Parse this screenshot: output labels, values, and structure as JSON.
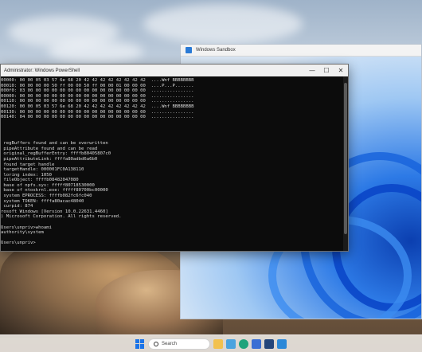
{
  "sandbox": {
    "title": "Windows Sandbox"
  },
  "powershell": {
    "title": "Administrator: Windows PowerShell",
    "lines": [
      "00000: 00 00 05 03 57 6e 68 20 42 42 42 42 42 42 42 42  ....Wnf BBBBBBBB",
      "00010: 00 00 00 00 50 ff 00 00 50 ff 00 00 01 00 00 00  ....P...P.......",
      "000f0: 03 00 00 00 00 00 00 00 00 00 00 00 00 00 00 00  ................",
      "00000: 00 00 00 00 00 00 00 00 00 00 00 00 00 00 00 00  ................",
      "00110: 00 00 00 00 00 00 00 00 00 00 00 00 00 00 00 00  ................",
      "00120: 00 00 05 03 57 6e 68 20 42 42 42 42 42 42 42 42  ....Wnf BBBBBBBB",
      "00130: 00 00 00 00 00 00 00 00 00 00 00 00 00 00 00 00  ................",
      "00140: 04 00 00 00 00 00 00 00 00 00 00 00 00 00 00 00  ................",
      "",
      "",
      "",
      "",
      " regBuffers found and can be overwritten",
      " pipeAttribute found and can be read",
      " original_regBufferEntry: ffffb80405807c0",
      " pipeAttributeLink: ffffa80adbd6a6b0",
      " found target handle",
      " targetHandle: 000001FC0A138110",
      " loring index: 1050",
      " fileObject: ffffb08482047080",
      " base of npfs.sys: fffff80718530000",
      " base of ntoskrnl.exe: fffff80700bc00000",
      " system EPROCESS: ffffb082fc6fc040",
      " system TOKEN: ffffa80acac48040",
      " curpid: 874",
      "rosoft Windows [Version 10.0.22631.4460]",
      ") Microsoft Corporation. All rights reserved.",
      "",
      "Users\\unpriv>whoami",
      "authority\\system",
      "",
      "Users\\unpriv>"
    ]
  },
  "taskbar": {
    "search_placeholder": "Search"
  }
}
